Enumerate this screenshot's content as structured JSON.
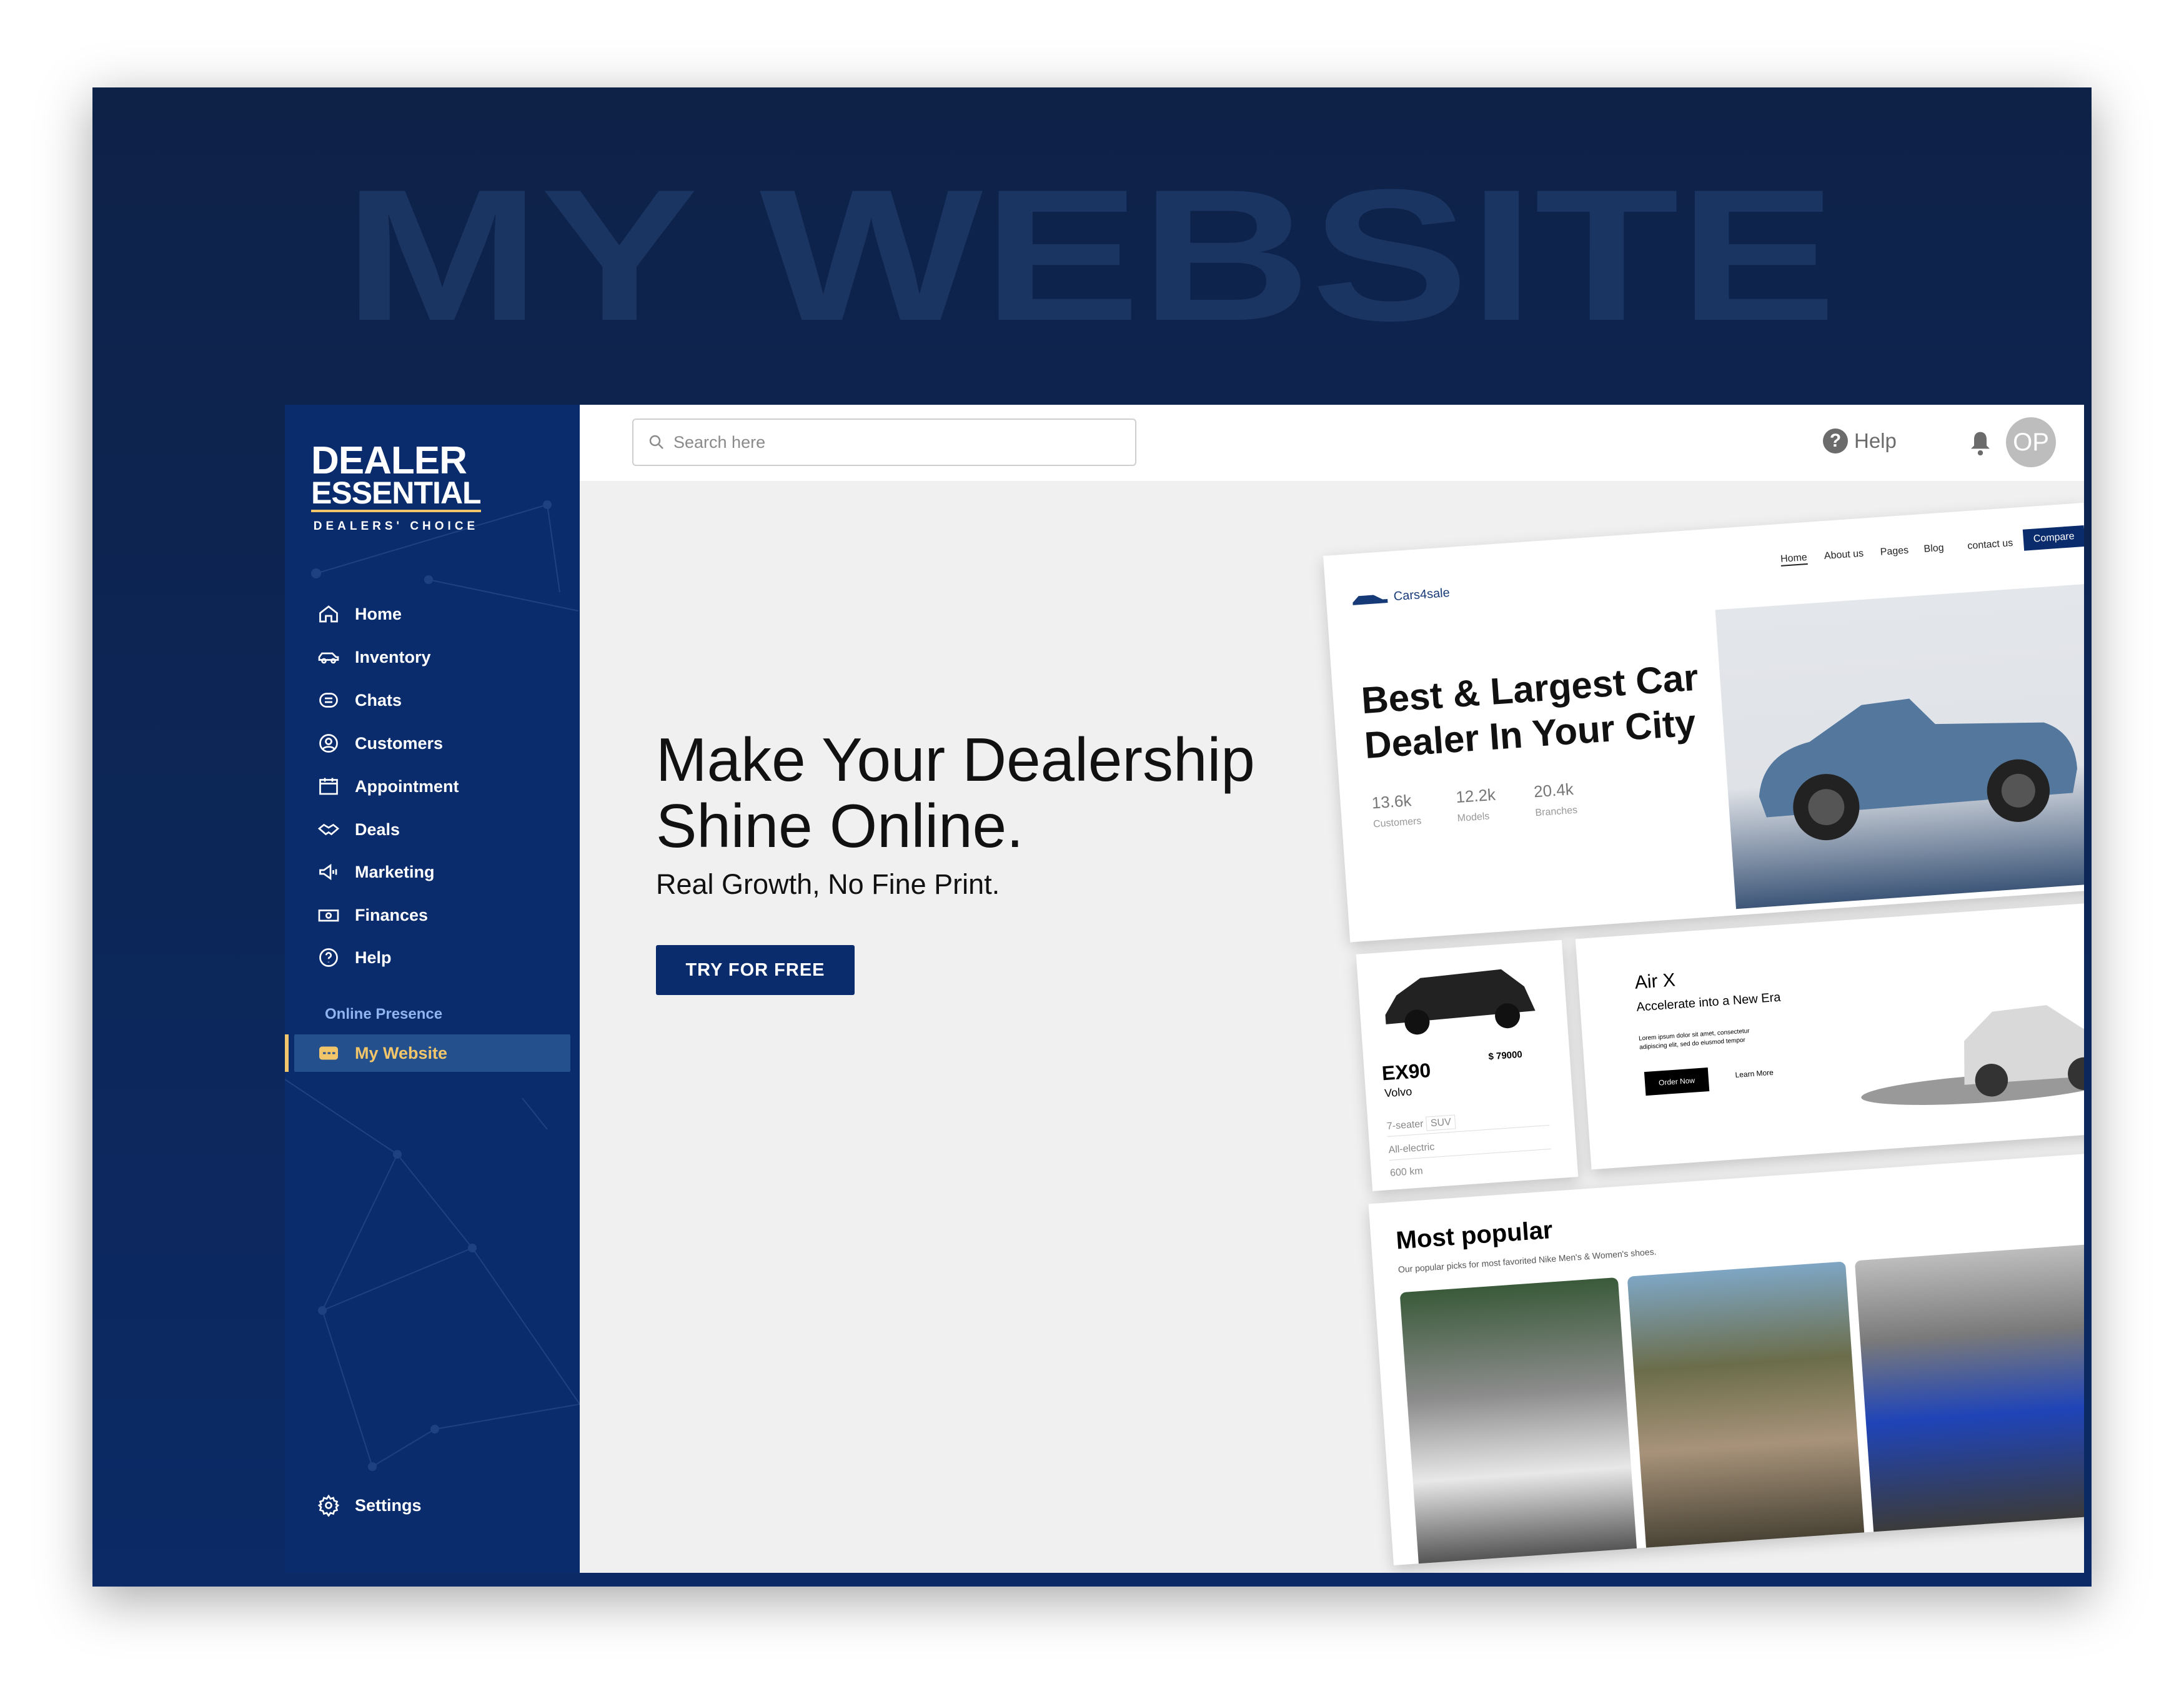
{
  "watermark": "MY WEBSITE",
  "logo": {
    "line1": "DEALER",
    "line2": "ESSENTIAL",
    "tagline": "DEALERS' CHOICE"
  },
  "sidebar": {
    "items": [
      {
        "label": "Home",
        "icon": "home-icon"
      },
      {
        "label": "Inventory",
        "icon": "car-icon"
      },
      {
        "label": "Chats",
        "icon": "chat-icon"
      },
      {
        "label": "Customers",
        "icon": "user-circle-icon"
      },
      {
        "label": "Appointment",
        "icon": "calendar-icon"
      },
      {
        "label": "Deals",
        "icon": "handshake-icon"
      },
      {
        "label": "Marketing",
        "icon": "megaphone-icon"
      },
      {
        "label": "Finances",
        "icon": "money-icon"
      },
      {
        "label": "Help",
        "icon": "help-icon"
      }
    ],
    "section": "Online Presence",
    "active": {
      "label": "My Website",
      "icon": "storefront-icon"
    },
    "settings": "Settings",
    "colors": {
      "bg": "#0a2c6c",
      "active": "#24508e",
      "accent": "#f1c66b"
    }
  },
  "topbar": {
    "search_placeholder": "Search here",
    "help": "Help",
    "avatar": "OP"
  },
  "hero": {
    "title_line1": "Make Your Dealership",
    "title_line2": "Shine Online.",
    "subtitle": "Real Growth, No Fine Print.",
    "cta": "TRY FOR FREE"
  },
  "mockup": {
    "brand": "Cars4sale",
    "nav": [
      "Home",
      "About us",
      "Pages",
      "Blog",
      "contact us"
    ],
    "compare": "Compare",
    "title": "Best & Largest Car Dealer In Your City",
    "stats": [
      {
        "value": "13.6k",
        "label": "Customers"
      },
      {
        "value": "12.2k",
        "label": "Models"
      },
      {
        "value": "20.4k",
        "label": "Branches"
      }
    ],
    "product": {
      "model": "EX90",
      "make": "Volvo",
      "price": "$ 79000",
      "specs": [
        "7-seater",
        "SUV",
        "All-electric",
        "600 km"
      ]
    },
    "promo": {
      "title": "Air X",
      "subtitle": "Accelerate into a New Era",
      "body": "Lorem ipsum dolor sit amet, consectetur adipiscing elit, sed do eiusmod tempor",
      "order": "Order Now",
      "learn": "Learn More"
    },
    "popular": {
      "title": "Most popular",
      "subtitle": "Our popular picks for most favorited Nike Men's & Women's shoes."
    }
  }
}
